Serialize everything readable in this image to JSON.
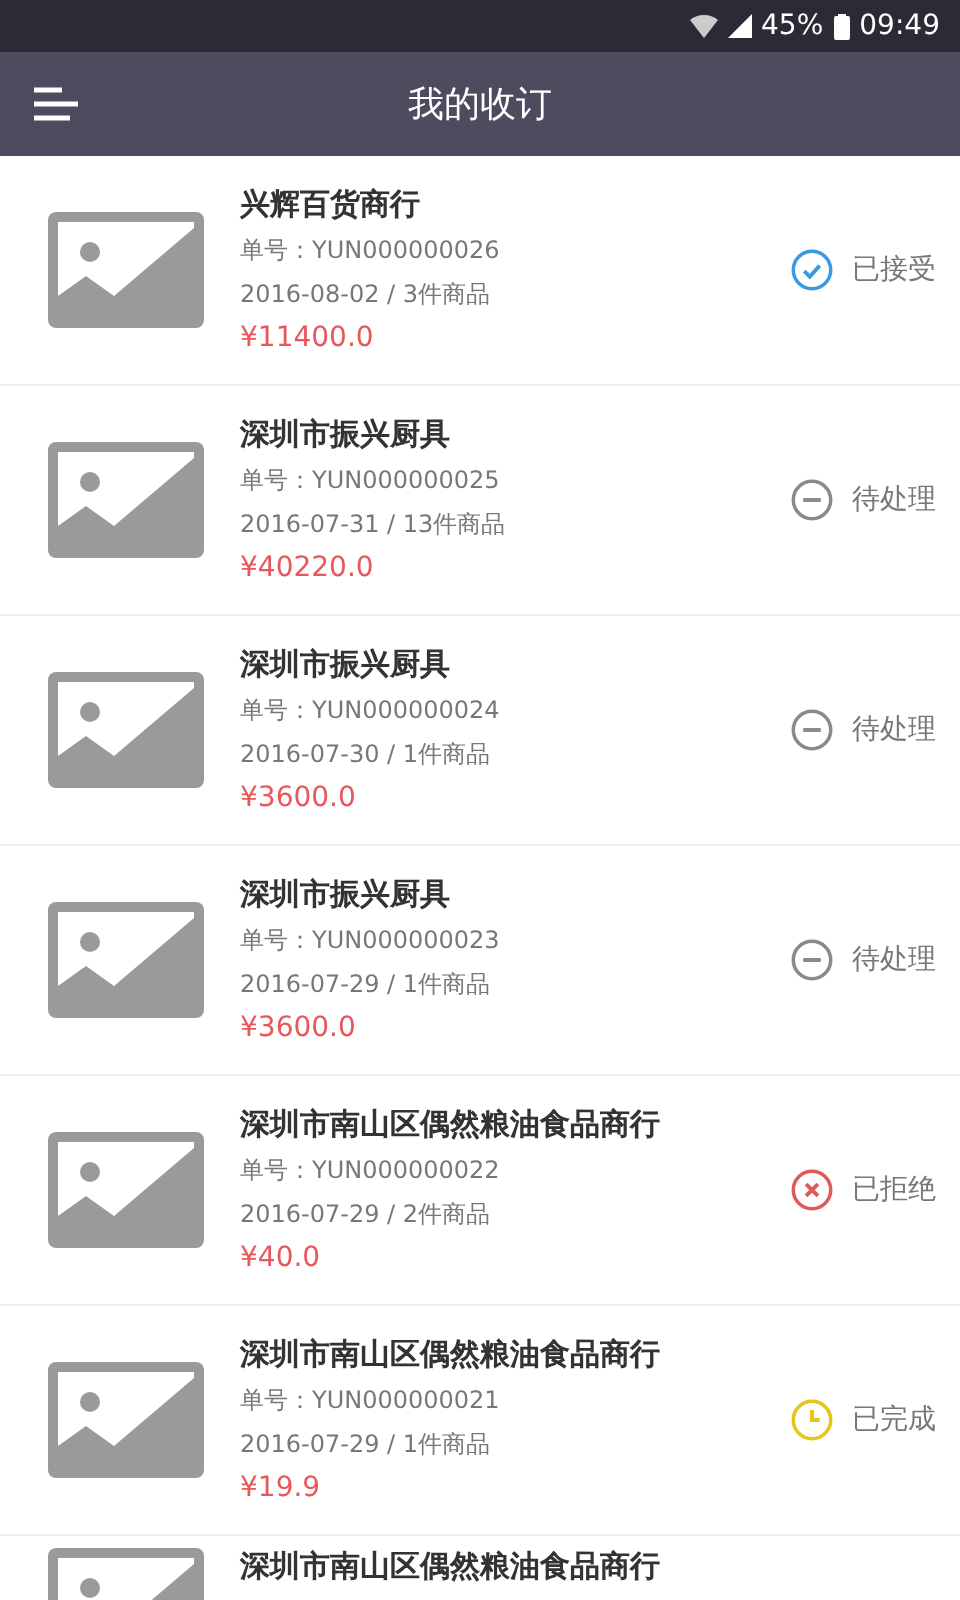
{
  "status_bar": {
    "battery": "45%",
    "time": "09:49"
  },
  "header": {
    "title": "我的收订"
  },
  "orders": [
    {
      "name": "兴辉百货商行",
      "number": "单号：YUN000000026",
      "date_items": "2016-08-02 / 3件商品",
      "amount": "¥11400.0",
      "status": {
        "kind": "accepted",
        "label": "已接受"
      }
    },
    {
      "name": "深圳市振兴厨具",
      "number": "单号：YUN000000025",
      "date_items": "2016-07-31 / 13件商品",
      "amount": "¥40220.0",
      "status": {
        "kind": "pending",
        "label": "待处理"
      }
    },
    {
      "name": "深圳市振兴厨具",
      "number": "单号：YUN000000024",
      "date_items": "2016-07-30 / 1件商品",
      "amount": "¥3600.0",
      "status": {
        "kind": "pending",
        "label": "待处理"
      }
    },
    {
      "name": "深圳市振兴厨具",
      "number": "单号：YUN000000023",
      "date_items": "2016-07-29 / 1件商品",
      "amount": "¥3600.0",
      "status": {
        "kind": "pending",
        "label": "待处理"
      }
    },
    {
      "name": "深圳市南山区偶然粮油食品商行",
      "number": "单号：YUN000000022",
      "date_items": "2016-07-29 / 2件商品",
      "amount": "¥40.0",
      "status": {
        "kind": "rejected",
        "label": "已拒绝"
      }
    },
    {
      "name": "深圳市南山区偶然粮油食品商行",
      "number": "单号：YUN000000021",
      "date_items": "2016-07-29 / 1件商品",
      "amount": "¥19.9",
      "status": {
        "kind": "completed",
        "label": "已完成"
      }
    },
    {
      "name": "深圳市南山区偶然粮油食品商行"
    }
  ]
}
